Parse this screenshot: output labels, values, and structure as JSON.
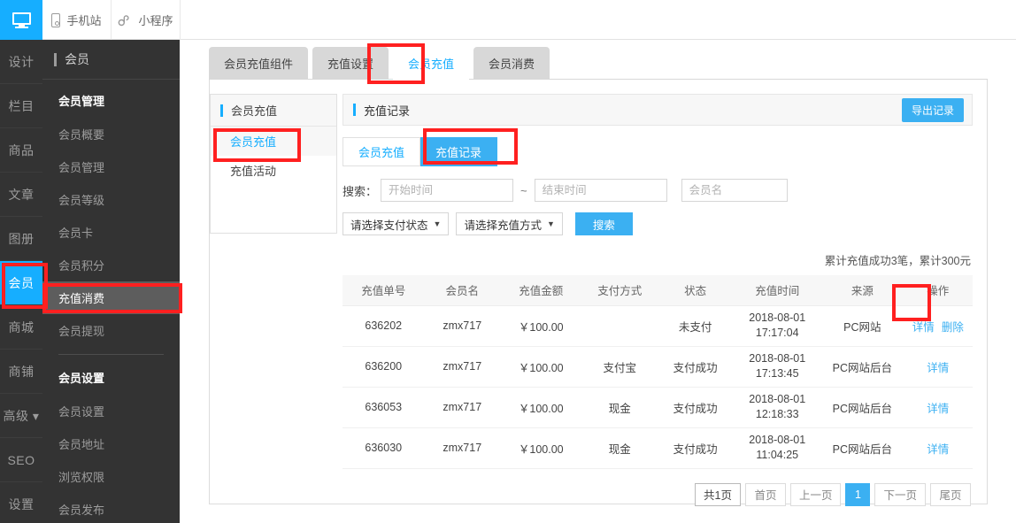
{
  "topbar": {
    "items": [
      {
        "label": "",
        "icon": "monitor-icon",
        "active": true
      },
      {
        "label": "手机站",
        "icon": "phone-icon",
        "active": false
      },
      {
        "label": "小程序",
        "icon": "mini-program-icon",
        "active": false
      }
    ],
    "mobile_label": "手机站",
    "mini_label": "小程序"
  },
  "rail": {
    "items": [
      {
        "label": "设计"
      },
      {
        "label": "栏目"
      },
      {
        "label": "商品"
      },
      {
        "label": "文章"
      },
      {
        "label": "图册"
      },
      {
        "label": "会员"
      },
      {
        "label": "商城"
      },
      {
        "label": "商铺"
      },
      {
        "label": "高级 ▾"
      },
      {
        "label": "SEO"
      },
      {
        "label": "设置"
      }
    ]
  },
  "sidenav": {
    "title": "会员",
    "group1": "会员管理",
    "group1_items": [
      {
        "label": "会员概要"
      },
      {
        "label": "会员管理"
      },
      {
        "label": "会员等级"
      },
      {
        "label": "会员卡"
      },
      {
        "label": "会员积分"
      },
      {
        "label": "充值消费"
      },
      {
        "label": "会员提现"
      }
    ],
    "group2": "会员设置",
    "group2_items": [
      {
        "label": "会员设置"
      },
      {
        "label": "会员地址"
      },
      {
        "label": "浏览权限"
      },
      {
        "label": "会员发布"
      }
    ]
  },
  "tabs": [
    {
      "label": "会员充值组件"
    },
    {
      "label": "充值设置"
    },
    {
      "label": "会员充值"
    },
    {
      "label": "会员消费"
    }
  ],
  "inner_left": {
    "header": "会员充值",
    "items": [
      {
        "label": "会员充值"
      },
      {
        "label": "充值活动"
      }
    ]
  },
  "panel": {
    "title": "充值记录",
    "export_label": "导出记录",
    "subtabs": [
      {
        "label": "会员充值"
      },
      {
        "label": "充值记录"
      }
    ]
  },
  "search": {
    "label": "搜索：",
    "start_placeholder": "开始时间",
    "start_value": "",
    "separator": "~",
    "end_placeholder": "结束时间",
    "end_value": "",
    "member_placeholder": "会员名",
    "member_value": "",
    "pay_status_label": "请选择支付状态",
    "recharge_type_label": "请选择充值方式",
    "button_label": "搜索",
    "caret": "▼"
  },
  "summary": "累计充值成功3笔，累计300元",
  "table": {
    "columns": [
      "充值单号",
      "会员名",
      "充值金额",
      "支付方式",
      "状态",
      "充值时间",
      "来源",
      "操作"
    ],
    "rows": [
      {
        "order": "636202",
        "member": "zmx717",
        "amount": "￥100.00",
        "pay_method": "",
        "status": "未支付",
        "time_date": "2018-08-01",
        "time_clock": "17:17:04",
        "source": "PC网站",
        "detail": "详情",
        "delete": "删除"
      },
      {
        "order": "636200",
        "member": "zmx717",
        "amount": "￥100.00",
        "pay_method": "支付宝",
        "status": "支付成功",
        "time_date": "2018-08-01",
        "time_clock": "17:13:45",
        "source": "PC网站后台",
        "detail": "详情",
        "delete": ""
      },
      {
        "order": "636053",
        "member": "zmx717",
        "amount": "￥100.00",
        "pay_method": "现金",
        "status": "支付成功",
        "time_date": "2018-08-01",
        "time_clock": "12:18:33",
        "source": "PC网站后台",
        "detail": "详情",
        "delete": ""
      },
      {
        "order": "636030",
        "member": "zmx717",
        "amount": "￥100.00",
        "pay_method": "现金",
        "status": "支付成功",
        "time_date": "2018-08-01",
        "time_clock": "11:04:25",
        "source": "PC网站后台",
        "detail": "详情",
        "delete": ""
      }
    ]
  },
  "pager": {
    "total": "共1页",
    "first": "首页",
    "prev": "上一页",
    "current": "1",
    "next": "下一页",
    "last": "尾页"
  },
  "colors": {
    "accent": "#16aeff",
    "button_blue": "#3bb0f2",
    "dark_sidebar": "#333333",
    "annotation_red": "#ff2020"
  }
}
